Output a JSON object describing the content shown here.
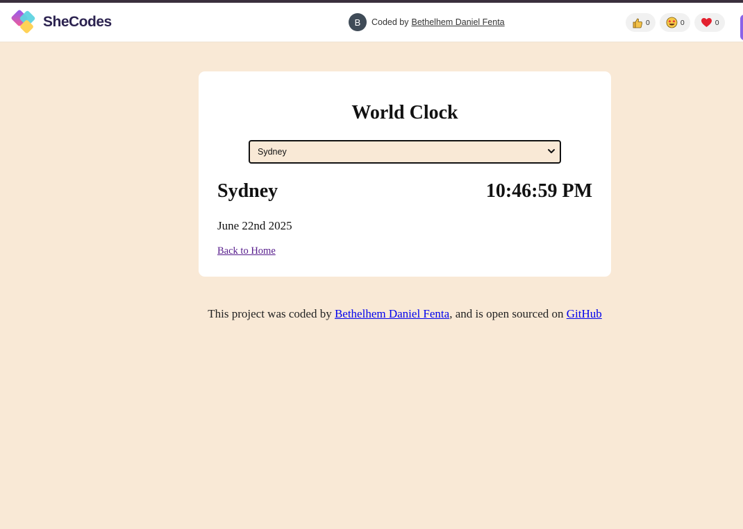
{
  "header": {
    "brand": "SheCodes",
    "coded_by_prefix": "Coded by",
    "author_name": "Bethelhem Daniel Fenta",
    "avatar_initial": "B",
    "reactions": [
      {
        "icon": "thumbs-up-icon",
        "count": "0"
      },
      {
        "icon": "star-struck-icon",
        "count": "0"
      },
      {
        "icon": "heart-icon",
        "count": "0"
      }
    ]
  },
  "card": {
    "title": "World Clock",
    "select_value": "Sydney",
    "city": "Sydney",
    "time": "10:46:59 PM",
    "date": "June 22nd 2025",
    "back_link": "Back to Home"
  },
  "footer": {
    "text_before": "This project was coded by ",
    "author_link": "Bethelhem Daniel Fenta",
    "text_middle": ", and is open sourced on ",
    "github_link": "GitHub"
  },
  "colors": {
    "page_background": "#f9e9d6",
    "brand_text": "#2c2350",
    "accent_purple": "#8a63e8"
  }
}
